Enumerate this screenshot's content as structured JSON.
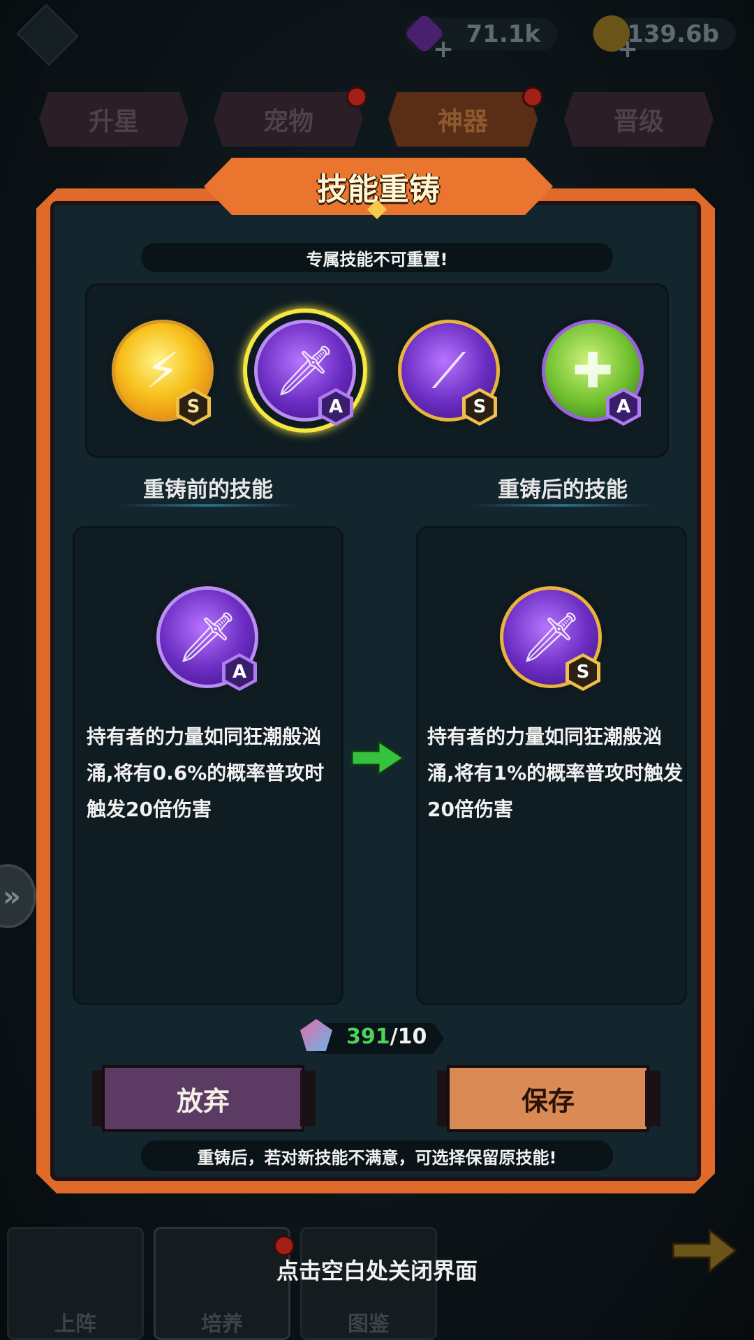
{
  "header": {
    "gems": "71.1k",
    "gold": "139.6b"
  },
  "tabs": [
    {
      "label": "升星",
      "active": false,
      "dot": false
    },
    {
      "label": "宠物",
      "active": false,
      "dot": true
    },
    {
      "label": "神器",
      "active": true,
      "dot": true
    },
    {
      "label": "晋级",
      "active": false,
      "dot": false
    }
  ],
  "dialog": {
    "title": "技能重铸",
    "notice": "专属技能不可重置!",
    "skills": [
      {
        "grade": "S",
        "color": "gold",
        "icon": "slash-skill-icon",
        "selected": false
      },
      {
        "grade": "A",
        "color": "purple",
        "icon": "sword-skill-icon",
        "selected": true
      },
      {
        "grade": "S",
        "color": "purple",
        "icon": "claw-skill-icon",
        "selected": false
      },
      {
        "grade": "A",
        "color": "green",
        "icon": "shield-skill-icon",
        "selected": false
      }
    ],
    "before": {
      "label": "重铸前的技能",
      "grade": "A",
      "description": "持有者的力量如同狂潮般汹涌,将有0.6%的概率普攻时触发20倍伤害"
    },
    "after": {
      "label": "重铸后的技能",
      "grade": "S",
      "description": "持有者的力量如同狂潮般汹涌,将有1%的概率普攻时触发20倍伤害"
    },
    "cost": {
      "owned": "391",
      "separator": "/",
      "required": "10"
    },
    "abandon_label": "放弃",
    "save_label": "保存",
    "footer_hint": "重铸后，若对新技能不满意，可选择保留原技能!"
  },
  "bottom_nav": [
    {
      "label": "上阵"
    },
    {
      "label": "培养"
    },
    {
      "label": "图鉴"
    }
  ],
  "close_hint": "点击空白处关闭界面",
  "colors": {
    "accent_orange": "#e06a2a",
    "panel": "#13252d",
    "green_value": "#4fd15a",
    "select_ring": "#f5e640"
  }
}
